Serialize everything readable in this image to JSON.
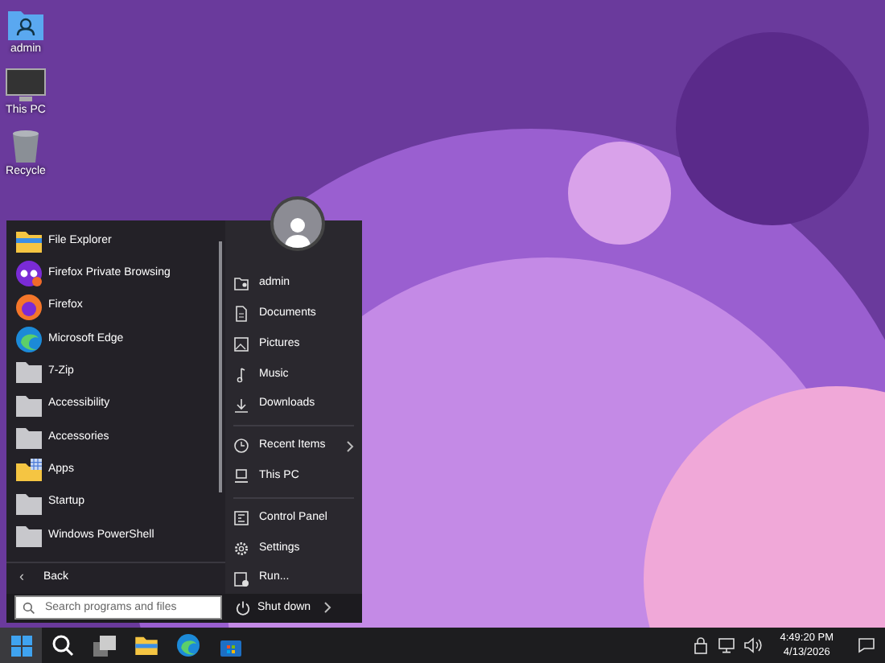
{
  "desktop_icons": [
    {
      "label": "admin",
      "kind": "user-folder"
    },
    {
      "label": "This PC",
      "kind": "monitor"
    },
    {
      "label": "Recycle",
      "kind": "bin"
    }
  ],
  "start_menu": {
    "programs": [
      {
        "label": "File Explorer",
        "kind": "explorer"
      },
      {
        "label": "Firefox Private Browsing",
        "kind": "private"
      },
      {
        "label": "Firefox",
        "kind": "firefox"
      },
      {
        "label": "Microsoft Edge",
        "kind": "edge"
      },
      {
        "label": "7-Zip",
        "kind": "folder"
      },
      {
        "label": "Accessibility",
        "kind": "folder"
      },
      {
        "label": "Accessories",
        "kind": "folder"
      },
      {
        "label": "Apps",
        "kind": "apps"
      },
      {
        "label": "Startup",
        "kind": "folder"
      },
      {
        "label": "Windows PowerShell",
        "kind": "folder"
      }
    ],
    "back": {
      "icon": "‹",
      "label": "Back"
    },
    "search": {
      "placeholder": "Search programs and files"
    },
    "places": [
      {
        "items": [
          {
            "label": "admin",
            "kind": "user"
          },
          {
            "label": "Documents",
            "kind": "doc"
          },
          {
            "label": "Pictures",
            "kind": "picture"
          },
          {
            "label": "Music",
            "kind": "music"
          },
          {
            "label": "Downloads",
            "kind": "download"
          }
        ]
      },
      {
        "items": [
          {
            "label": "Recent Items",
            "kind": "clock",
            "submenu": true
          },
          {
            "label": "This PC",
            "kind": "pc"
          }
        ]
      },
      {
        "items": [
          {
            "label": "Control Panel",
            "kind": "panel"
          },
          {
            "label": "Settings",
            "kind": "gear"
          },
          {
            "label": "Run...",
            "kind": "run"
          }
        ]
      }
    ],
    "shutdown": {
      "label": "Shut down"
    }
  },
  "taskbar": {
    "apps": [
      {
        "kind": "start",
        "selected": true
      },
      {
        "kind": "search",
        "selected": false
      },
      {
        "kind": "taskview",
        "selected": false
      },
      {
        "kind": "explorer",
        "selected": false
      },
      {
        "kind": "edge",
        "selected": false
      },
      {
        "kind": "store",
        "selected": false
      }
    ],
    "time": "4:49:20 PM",
    "date": "4/13/2026"
  }
}
